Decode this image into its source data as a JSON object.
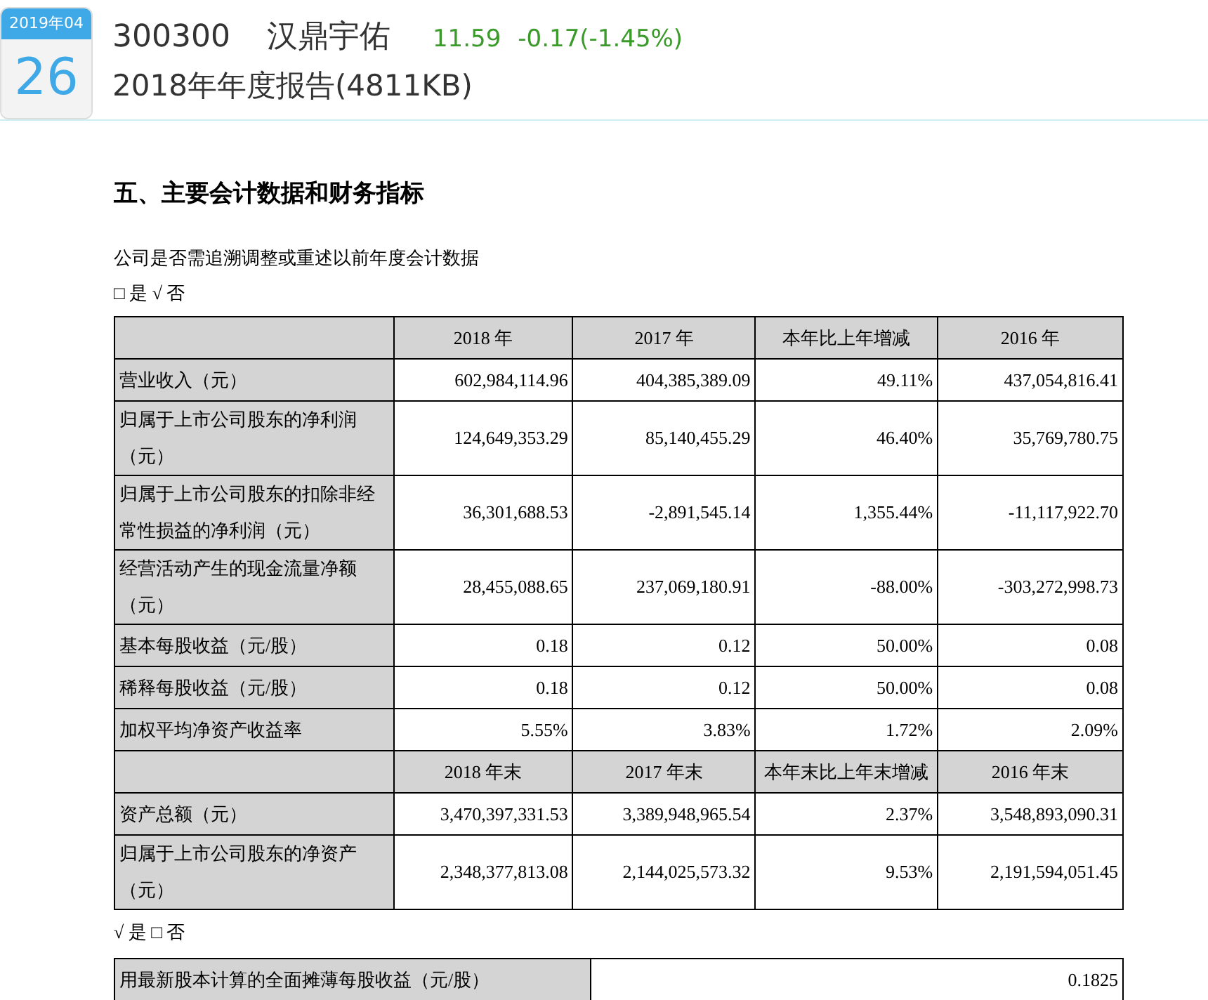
{
  "header": {
    "date_badge": {
      "month": "2019年04",
      "day": "26"
    },
    "stock_code": "300300",
    "stock_name": "汉鼎宇佑",
    "price": "11.59",
    "change": "-0.17(-1.45%)",
    "report_title": "2018年年度报告(4811KB)"
  },
  "document": {
    "heading": "五、主要会计数据和财务指标",
    "question": "公司是否需追溯调整或重述以前年度会计数据",
    "answer_1": "□ 是 √ 否",
    "table": {
      "rows": [
        {
          "kind": "header",
          "cells": [
            "",
            "2018 年",
            "2017 年",
            "本年比上年增减",
            "2016 年"
          ]
        },
        {
          "kind": "data",
          "cells": [
            "营业收入（元）",
            "602,984,114.96",
            "404,385,389.09",
            "49.11%",
            "437,054,816.41"
          ]
        },
        {
          "kind": "data",
          "cells": [
            "归属于上市公司股东的净利润（元）",
            "124,649,353.29",
            "85,140,455.29",
            "46.40%",
            "35,769,780.75"
          ]
        },
        {
          "kind": "data",
          "cells": [
            "归属于上市公司股东的扣除非经常性损益的净利润（元）",
            "36,301,688.53",
            "-2,891,545.14",
            "1,355.44%",
            "-11,117,922.70"
          ]
        },
        {
          "kind": "data",
          "cells": [
            "经营活动产生的现金流量净额（元）",
            "28,455,088.65",
            "237,069,180.91",
            "-88.00%",
            "-303,272,998.73"
          ]
        },
        {
          "kind": "data",
          "cells": [
            "基本每股收益（元/股）",
            "0.18",
            "0.12",
            "50.00%",
            "0.08"
          ]
        },
        {
          "kind": "data",
          "cells": [
            "稀释每股收益（元/股）",
            "0.18",
            "0.12",
            "50.00%",
            "0.08"
          ]
        },
        {
          "kind": "data",
          "cells": [
            "加权平均净资产收益率",
            "5.55%",
            "3.83%",
            "1.72%",
            "2.09%"
          ]
        },
        {
          "kind": "header",
          "cells": [
            "",
            "2018 年末",
            "2017 年末",
            "本年末比上年末增减",
            "2016 年末"
          ]
        },
        {
          "kind": "data",
          "cells": [
            "资产总额（元）",
            "3,470,397,331.53",
            "3,389,948,965.54",
            "2.37%",
            "3,548,893,090.31"
          ]
        },
        {
          "kind": "data",
          "cells": [
            "归属于上市公司股东的净资产（元）",
            "2,348,377,813.08",
            "2,144,025,573.32",
            "9.53%",
            "2,191,594,051.45"
          ]
        }
      ]
    },
    "answer_2": "√ 是 □ 否",
    "eps_table": {
      "label": "用最新股本计算的全面摊薄每股收益（元/股）",
      "value": "0.1825"
    }
  }
}
